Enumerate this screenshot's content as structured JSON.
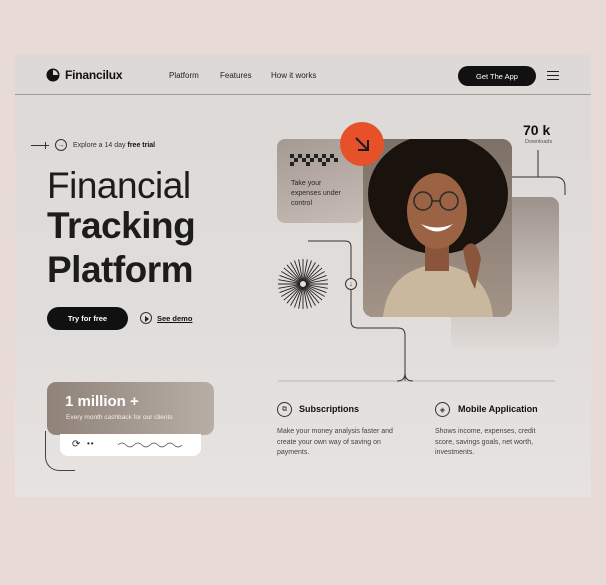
{
  "brand": {
    "name": "Financilux"
  },
  "nav": {
    "links": [
      "Platform",
      "Features",
      "How it works"
    ],
    "cta": "Get The App"
  },
  "hero": {
    "trial_prefix": "Explore a 14 day",
    "trial_bold": "free trial",
    "title_line1": "Financial",
    "title_line2": "Tracking",
    "title_line3": "Platform",
    "primary_button": "Try for free",
    "secondary_button": "See demo"
  },
  "stat": {
    "value": "1 million +",
    "caption": "Every month cashback for our clients"
  },
  "card": {
    "text": "Take your expenses under control"
  },
  "downloads": {
    "value": "70 k",
    "label": "Downloads"
  },
  "features": [
    {
      "title": "Subscriptions",
      "desc": "Make your money analysis faster and create  your own way of saving on payments.",
      "icon": "repeat-icon"
    },
    {
      "title": "Mobile Application",
      "desc": "Shows income, expenses, credit score, savings goals, net worth, investments.",
      "icon": "layers-icon"
    }
  ],
  "colors": {
    "accent": "#e6512a",
    "dark": "#111111",
    "background": "#e8dbd7"
  }
}
